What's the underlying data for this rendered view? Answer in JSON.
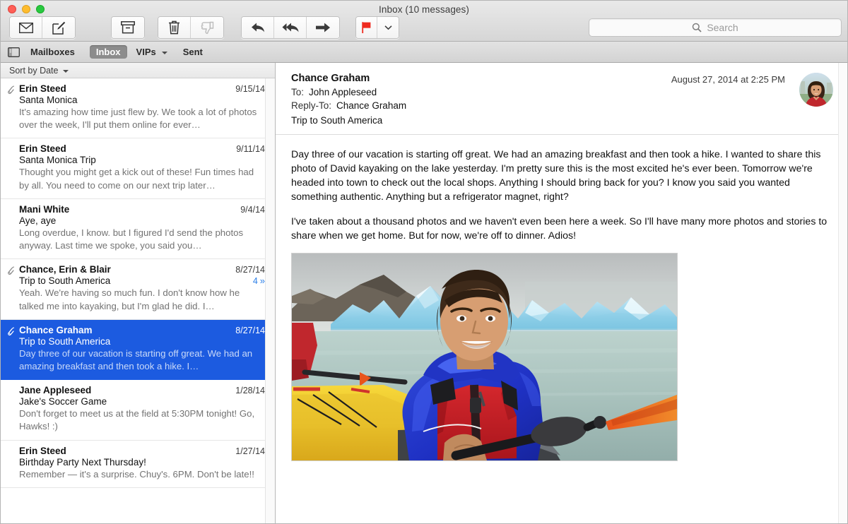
{
  "window": {
    "title": "Inbox (10 messages)",
    "controls": [
      "close",
      "minimize",
      "maximize"
    ]
  },
  "toolbar": {
    "groups": [
      {
        "name": "mail",
        "buttons": [
          {
            "name": "get-mail-button",
            "icon": "envelope-icon",
            "label": "Get Mail",
            "dim": false
          },
          {
            "name": "compose-button",
            "icon": "compose-icon",
            "label": "New Message",
            "dim": false
          }
        ]
      },
      {
        "name": "file",
        "buttons": [
          {
            "name": "archive-button",
            "icon": "archive-icon",
            "label": "Archive",
            "dim": false
          }
        ]
      },
      {
        "name": "delete",
        "buttons": [
          {
            "name": "delete-button",
            "icon": "trash-icon",
            "label": "Delete",
            "dim": false
          },
          {
            "name": "junk-button",
            "icon": "thumbs-down-icon",
            "label": "Junk",
            "dim": true
          }
        ]
      },
      {
        "name": "reply",
        "buttons": [
          {
            "name": "reply-button",
            "icon": "reply-arrow-icon",
            "label": "Reply",
            "dim": false
          },
          {
            "name": "reply-all-button",
            "icon": "reply-all-arrow-icon",
            "label": "Reply All",
            "dim": false
          },
          {
            "name": "forward-button",
            "icon": "forward-arrow-icon",
            "label": "Forward",
            "dim": false
          }
        ]
      },
      {
        "name": "flag",
        "buttons": [
          {
            "name": "flag-button",
            "icon": "red-flag-icon",
            "label": "Flag",
            "dim": false
          },
          {
            "name": "flag-menu-button",
            "icon": "chevron-down-icon",
            "label": "Flag Options",
            "dim": false
          }
        ]
      }
    ],
    "flag_color": "#ef2b1f"
  },
  "search": {
    "placeholder": "Search",
    "value": "",
    "icon": "search-icon"
  },
  "favorites_bar": {
    "sidebar_toggle_icon": "sidebar-toggle-icon",
    "mailboxes_label": "Mailboxes",
    "items": [
      {
        "label": "Inbox",
        "selected": true,
        "has_chevron": false
      },
      {
        "label": "VIPs",
        "selected": false,
        "has_chevron": true
      },
      {
        "label": "Sent",
        "selected": false,
        "has_chevron": false
      }
    ]
  },
  "list": {
    "sort_label": "Sort by Date",
    "sort_chevron_icon": "chevron-down-icon",
    "messages": [
      {
        "sender": "Erin Steed",
        "date": "9/15/14",
        "subject": "Santa Monica",
        "preview": "It's amazing how time just flew by. We took a lot of photos over the week, I'll put them online for ever…",
        "attachment": true,
        "selected": false,
        "thread_count": ""
      },
      {
        "sender": "Erin Steed",
        "date": "9/11/14",
        "subject": "Santa Monica Trip",
        "preview": "Thought you might get a kick out of these! Fun times had by all. You need to come on our next trip later…",
        "attachment": false,
        "selected": false,
        "thread_count": ""
      },
      {
        "sender": "Mani White",
        "date": "9/4/14",
        "subject": "Aye, aye",
        "preview": "Long overdue, I know. but I figured I'd send the photos anyway. Last time we spoke, you said you…",
        "attachment": false,
        "selected": false,
        "thread_count": ""
      },
      {
        "sender": "Chance, Erin & Blair",
        "date": "8/27/14",
        "subject": "Trip to South America",
        "preview": "Yeah. We're having so much fun. I don't know how he talked me into kayaking, but I'm glad he did. I…",
        "attachment": true,
        "selected": false,
        "thread_count": "4"
      },
      {
        "sender": "Chance Graham",
        "date": "8/27/14",
        "subject": "Trip to South America",
        "preview": "Day three of our vacation is starting off great. We had an amazing breakfast and then took a hike. I…",
        "attachment": true,
        "selected": true,
        "thread_count": ""
      },
      {
        "sender": "Jane Appleseed",
        "date": "1/28/14",
        "subject": "Jake's Soccer Game",
        "preview": "Don't forget to meet us at the field at 5:30PM tonight! Go, Hawks! :)",
        "attachment": false,
        "selected": false,
        "thread_count": ""
      },
      {
        "sender": "Erin Steed",
        "date": "1/27/14",
        "subject": "Birthday Party Next Thursday!",
        "preview": "Remember — it's a surprise. Chuy's. 6PM. Don't be late!!",
        "attachment": false,
        "selected": false,
        "thread_count": ""
      }
    ]
  },
  "message": {
    "from": "Chance Graham",
    "date": "August 27, 2014 at 2:25 PM",
    "to_label": "To:",
    "to_value": "John Appleseed",
    "reply_to_label": "Reply-To:",
    "reply_to_value": "Chance Graham",
    "subject": "Trip to South America",
    "avatar_name": "avatar",
    "body_paragraphs": [
      "Day three of our vacation is starting off great. We had an amazing breakfast and then took a hike. I wanted to share this photo of David kayaking on the lake yesterday. I'm pretty sure this is the most excited he's ever been. Tomorrow we're headed into town to check out the local shops. Anything I should bring back for you? I know you said you wanted something authentic. Anything but a refrigerator magnet, right?",
      "I've taken about a thousand photos and we haven't even been here a week. So I'll have many more photos and stories to share when we get home. But for now, we're off to dinner. Adios!"
    ],
    "attachment_image": "boy-kayaking-among-icebergs-photo"
  },
  "colors": {
    "selection_blue": "#1c5be0",
    "accent_link": "#2b7fe8",
    "flag_red": "#ef2b1f"
  }
}
